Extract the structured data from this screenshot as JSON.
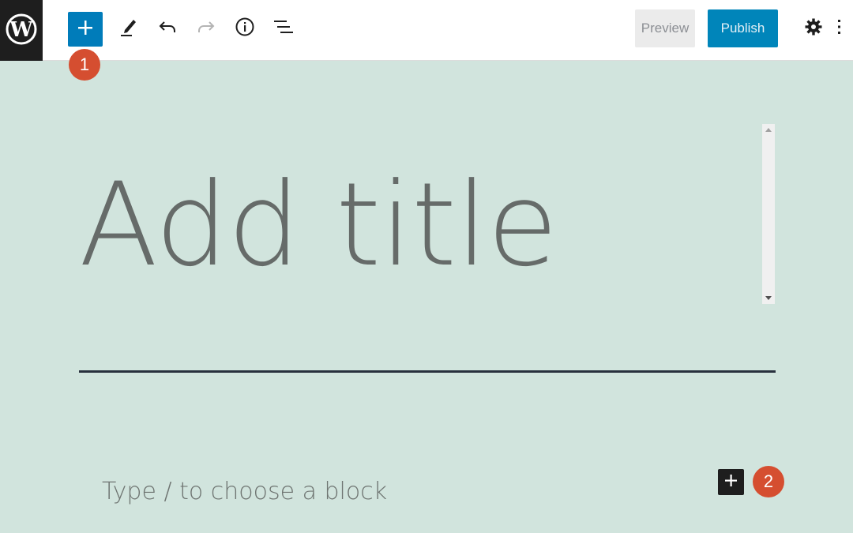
{
  "toolbar": {
    "logo_icon": "wordpress-logo-icon",
    "inserter_icon": "plus-icon",
    "tools": [
      {
        "name": "edit-tool",
        "icon": "pencil-icon"
      },
      {
        "name": "undo",
        "icon": "undo-icon"
      },
      {
        "name": "redo",
        "icon": "redo-icon"
      },
      {
        "name": "details",
        "icon": "info-icon"
      },
      {
        "name": "list-view",
        "icon": "list-view-icon"
      }
    ],
    "preview_label": "Preview",
    "publish_label": "Publish",
    "settings_icon": "gear-icon",
    "options_icon": "kebab-menu-icon"
  },
  "annotations": {
    "badge_1": "1",
    "badge_2": "2"
  },
  "editor": {
    "title_placeholder": "Add title",
    "block_placeholder": "Type / to choose a block",
    "add_block_icon": "plus-icon"
  },
  "colors": {
    "canvas_background": "#d1e4dd",
    "accent_blue": "#007cba",
    "publish_blue": "#0085ba",
    "badge_red": "#d54e30",
    "dark": "#1e1e1e"
  }
}
